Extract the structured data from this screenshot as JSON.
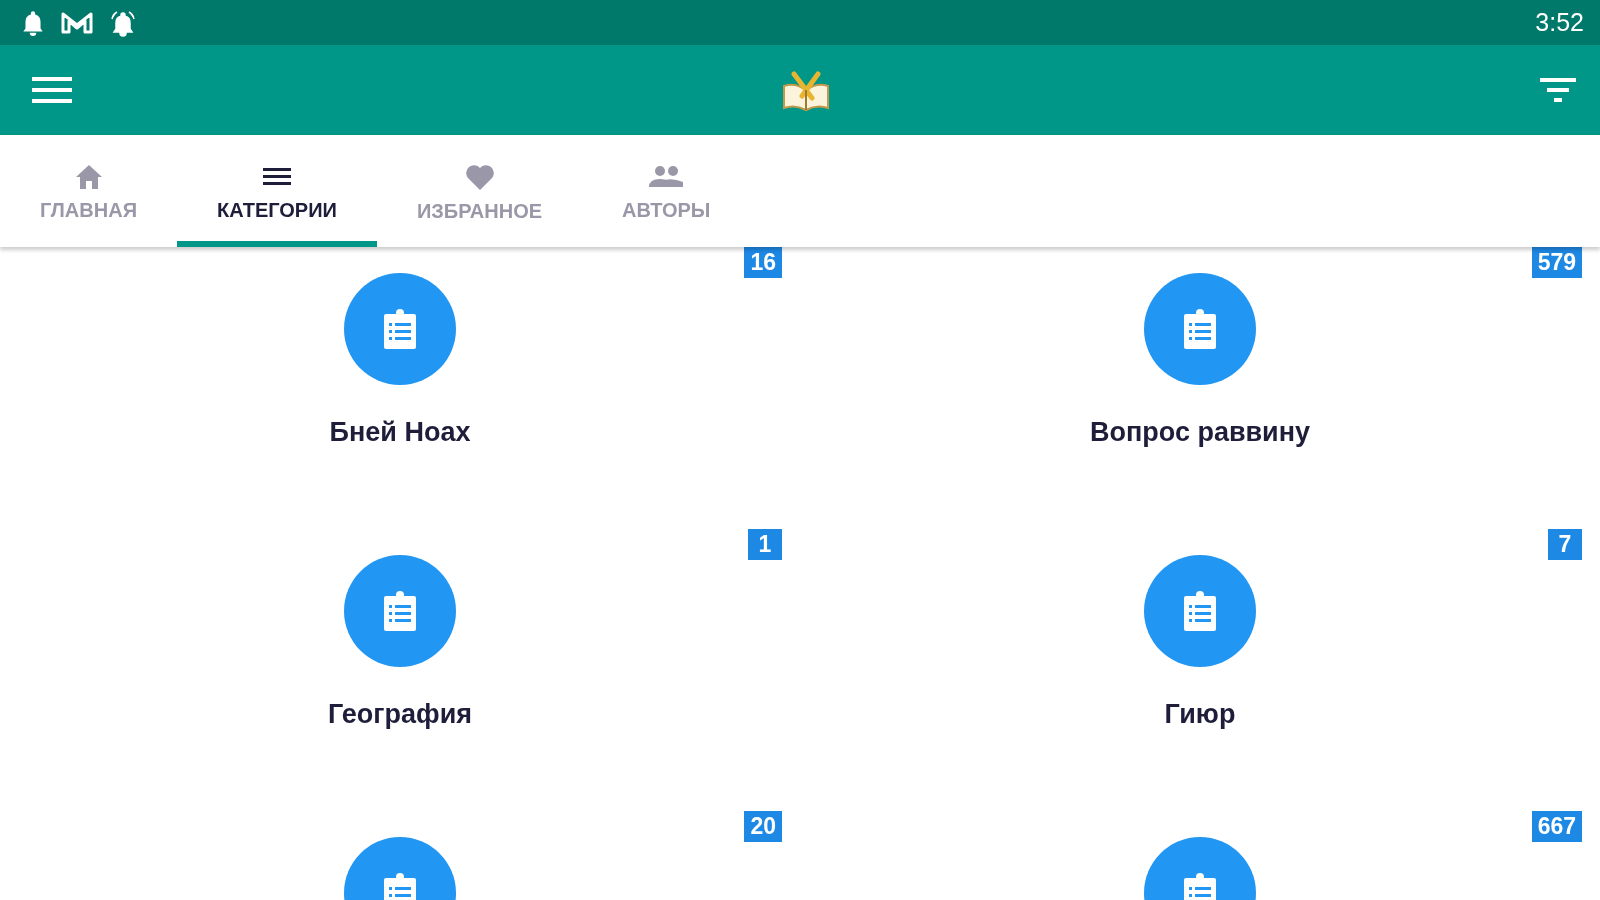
{
  "status_bar": {
    "time": "3:52"
  },
  "tabs": [
    {
      "label": "ГЛАВНАЯ",
      "kind": "home",
      "selected": false
    },
    {
      "label": "КАТЕГОРИИ",
      "kind": "list",
      "selected": true
    },
    {
      "label": "ИЗБРАННОЕ",
      "kind": "heart",
      "selected": false
    },
    {
      "label": "АВТОРЫ",
      "kind": "people",
      "selected": false
    }
  ],
  "categories": [
    {
      "label": "Бней Ноах",
      "count": "16"
    },
    {
      "label": "Вопрос раввину",
      "count": "579"
    },
    {
      "label": "География",
      "count": "1"
    },
    {
      "label": "Гиюр",
      "count": "7"
    },
    {
      "count": "20"
    },
    {
      "count": "667"
    }
  ]
}
